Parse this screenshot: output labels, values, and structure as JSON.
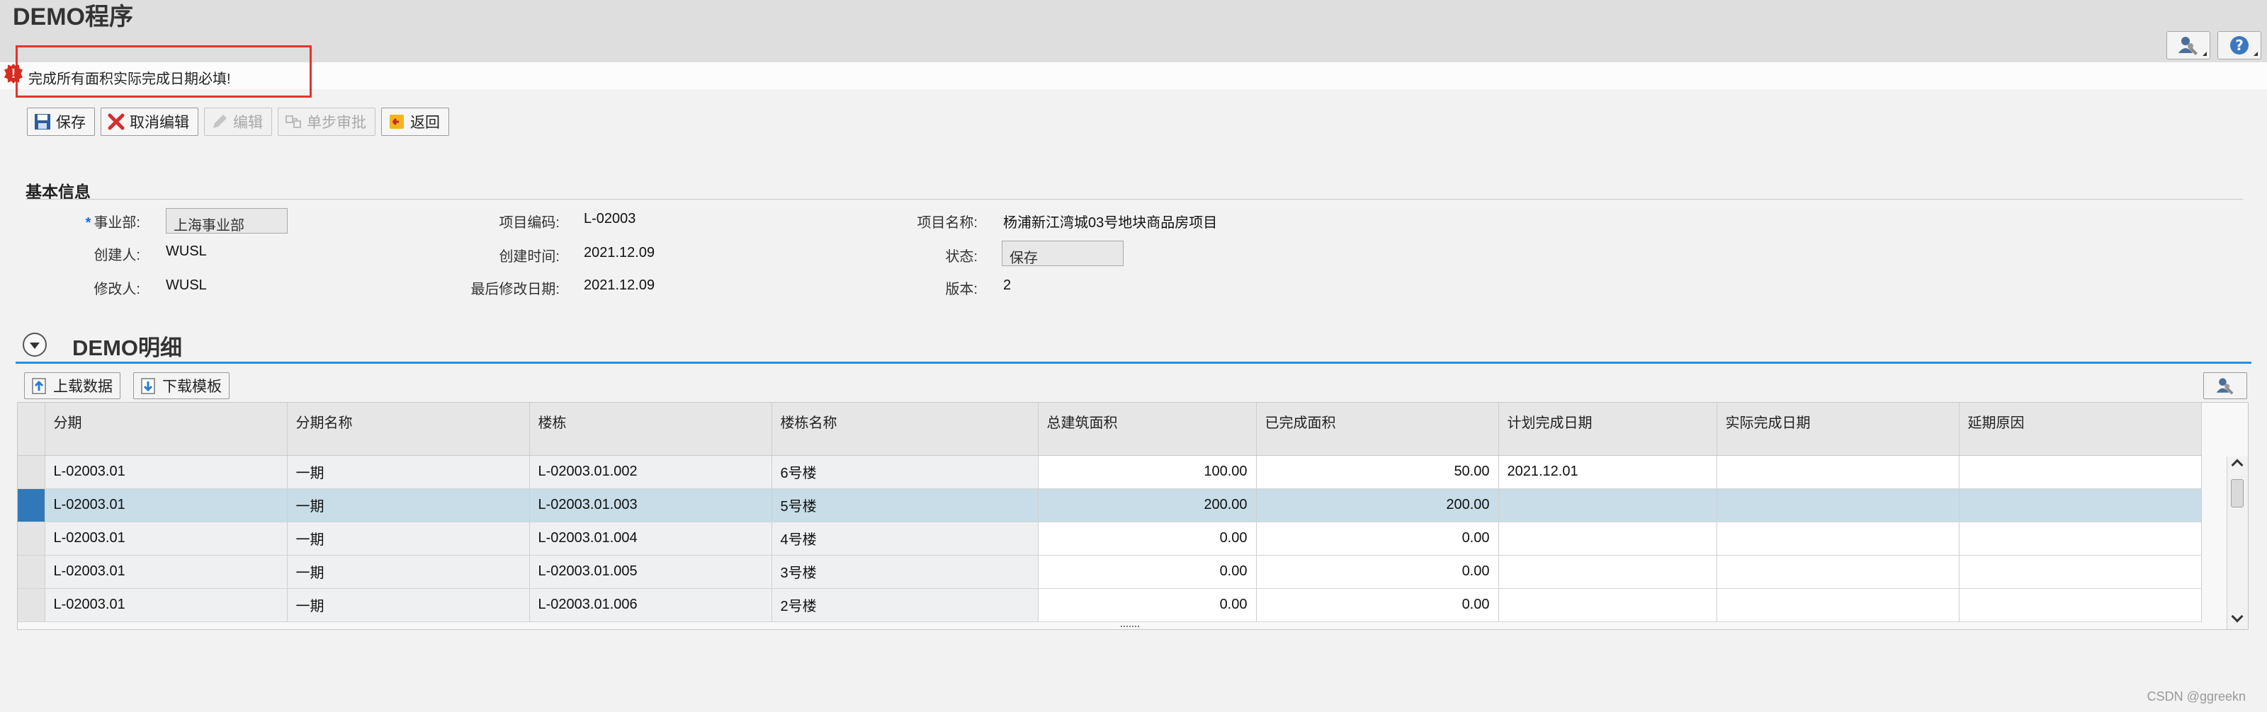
{
  "app": {
    "title": "DEMO程序"
  },
  "header_buttons": [
    {
      "icon": "user-settings-icon"
    },
    {
      "icon": "help-icon"
    }
  ],
  "message": {
    "type": "error",
    "text": "完成所有面积实际完成日期必填!"
  },
  "toolbar": {
    "save": "保存",
    "cancel_edit": "取消编辑",
    "edit": "编辑",
    "single_approve": "单步审批",
    "back": "返回"
  },
  "basic_info": {
    "title": "基本信息",
    "division_label": "事业部:",
    "division_value": "上海事业部",
    "project_code_label": "项目编码:",
    "project_code_value": "L-02003",
    "project_name_label": "项目名称:",
    "project_name_value": "杨浦新江湾城03号地块商品房项目",
    "creator_label": "创建人:",
    "creator_value": "WUSL",
    "created_time_label": "创建时间:",
    "created_time_value": "2021.12.09",
    "status_label": "状态:",
    "status_value": "保存",
    "modifier_label": "修改人:",
    "modifier_value": "WUSL",
    "last_modified_label": "最后修改日期:",
    "last_modified_value": "2021.12.09",
    "version_label": "版本:",
    "version_value": "2"
  },
  "detail": {
    "title": "DEMO明细",
    "upload_label": "上载数据",
    "download_label": "下载模板",
    "columns": [
      "分期",
      "分期名称",
      "楼栋",
      "楼栋名称",
      "总建筑面积",
      "已完成面积",
      "计划完成日期",
      "实际完成日期",
      "延期原因"
    ],
    "rows": [
      [
        "L-02003.01",
        "一期",
        "L-02003.01.002",
        "6号楼",
        "100.00",
        "50.00",
        "2021.12.01",
        "",
        ""
      ],
      [
        "L-02003.01",
        "一期",
        "L-02003.01.003",
        "5号楼",
        "200.00",
        "200.00",
        "",
        "",
        ""
      ],
      [
        "L-02003.01",
        "一期",
        "L-02003.01.004",
        "4号楼",
        "0.00",
        "0.00",
        "",
        "",
        ""
      ],
      [
        "L-02003.01",
        "一期",
        "L-02003.01.005",
        "3号楼",
        "0.00",
        "0.00",
        "",
        "",
        ""
      ],
      [
        "L-02003.01",
        "一期",
        "L-02003.01.006",
        "2号楼",
        "0.00",
        "0.00",
        "",
        "",
        ""
      ]
    ]
  },
  "watermark": "CSDN @ggreekn"
}
